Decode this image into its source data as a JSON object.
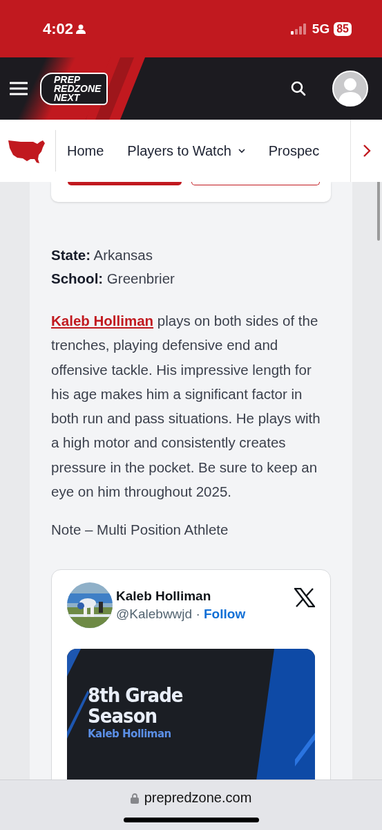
{
  "status_bar": {
    "time": "4:02",
    "network": "5G",
    "battery": "85"
  },
  "header": {
    "logo_lines": [
      "PREP",
      "REDZONE",
      "NEXT"
    ]
  },
  "nav": {
    "items": [
      {
        "label": "Home",
        "dropdown": false
      },
      {
        "label": "Players to Watch",
        "dropdown": true
      },
      {
        "label": "Prospec",
        "dropdown": false
      }
    ]
  },
  "profile": {
    "fields": [
      {
        "label": "State:",
        "value": "Arkansas"
      },
      {
        "label": "School:",
        "value": "Greenbrier"
      }
    ]
  },
  "bio": {
    "link": "Kaleb Holliman",
    "text": " plays on both sides of the trenches, playing defensive end and offensive tackle. His impressive length for his age makes him a significant factor in both run and pass situations. He plays with a high motor and consistently creates pressure in the pocket. Be sure to keep an eye on him throughout 2025."
  },
  "note": "Note – Multi Position Athlete",
  "tweet": {
    "name": "Kaleb Holliman",
    "handle": "@Kalebwwjd",
    "separator": "·",
    "follow": "Follow",
    "media_title": [
      "8th Grade",
      "Season"
    ],
    "media_subtitle": "Kaleb Holliman"
  },
  "url_bar": {
    "url": "prepredzone.com"
  }
}
